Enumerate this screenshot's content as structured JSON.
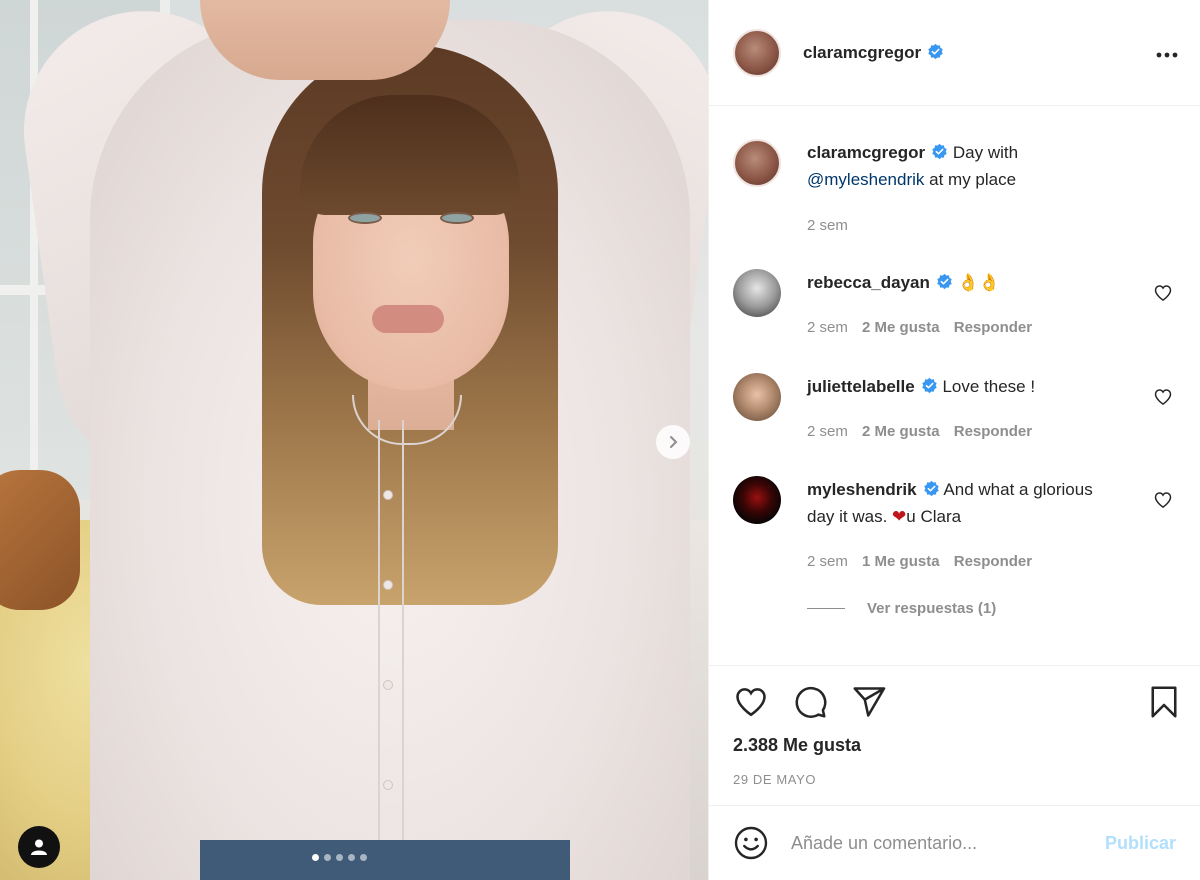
{
  "post": {
    "image_alt": "Woman in white shirt with arms raised over her head",
    "carousel": {
      "total": 5,
      "active": 0
    }
  },
  "header": {
    "username": "claramcgregor",
    "verified": true,
    "more_icon": "more-horizontal-icon"
  },
  "caption": {
    "username": "claramcgregor",
    "text_before": "Day with",
    "mention": "@myleshendrik",
    "text_after": "at my place",
    "time": "2 sem"
  },
  "comments": [
    {
      "username": "rebecca_dayan",
      "verified": true,
      "text": "👌👌",
      "time": "2 sem",
      "likes": "2 Me gusta",
      "reply": "Responder"
    },
    {
      "username": "juliettelabelle",
      "verified": true,
      "text": "Love these !",
      "time": "2 sem",
      "likes": "2 Me gusta",
      "reply": "Responder"
    },
    {
      "username": "myleshendrik",
      "verified": true,
      "text": "And what a glorious day it was. ",
      "text_heart": "❤",
      "text_end": "u Clara",
      "time": "2 sem",
      "likes": "1 Me gusta",
      "reply": "Responder"
    }
  ],
  "view_replies": "Ver respuestas (1)",
  "actions": {
    "like_icon": "heart-icon",
    "comment_icon": "comment-icon",
    "share_icon": "send-icon",
    "save_icon": "bookmark-icon"
  },
  "likes_count": "2.388 Me gusta",
  "post_date": "29 DE MAYO",
  "comment_box": {
    "placeholder": "Añade un comentario...",
    "submit_label": "Publicar"
  },
  "colors": {
    "verified_blue": "#3897f0",
    "link_blue": "#00376b",
    "publish_disabled": "#b2dffc",
    "meta_gray": "#8e8e8e"
  }
}
